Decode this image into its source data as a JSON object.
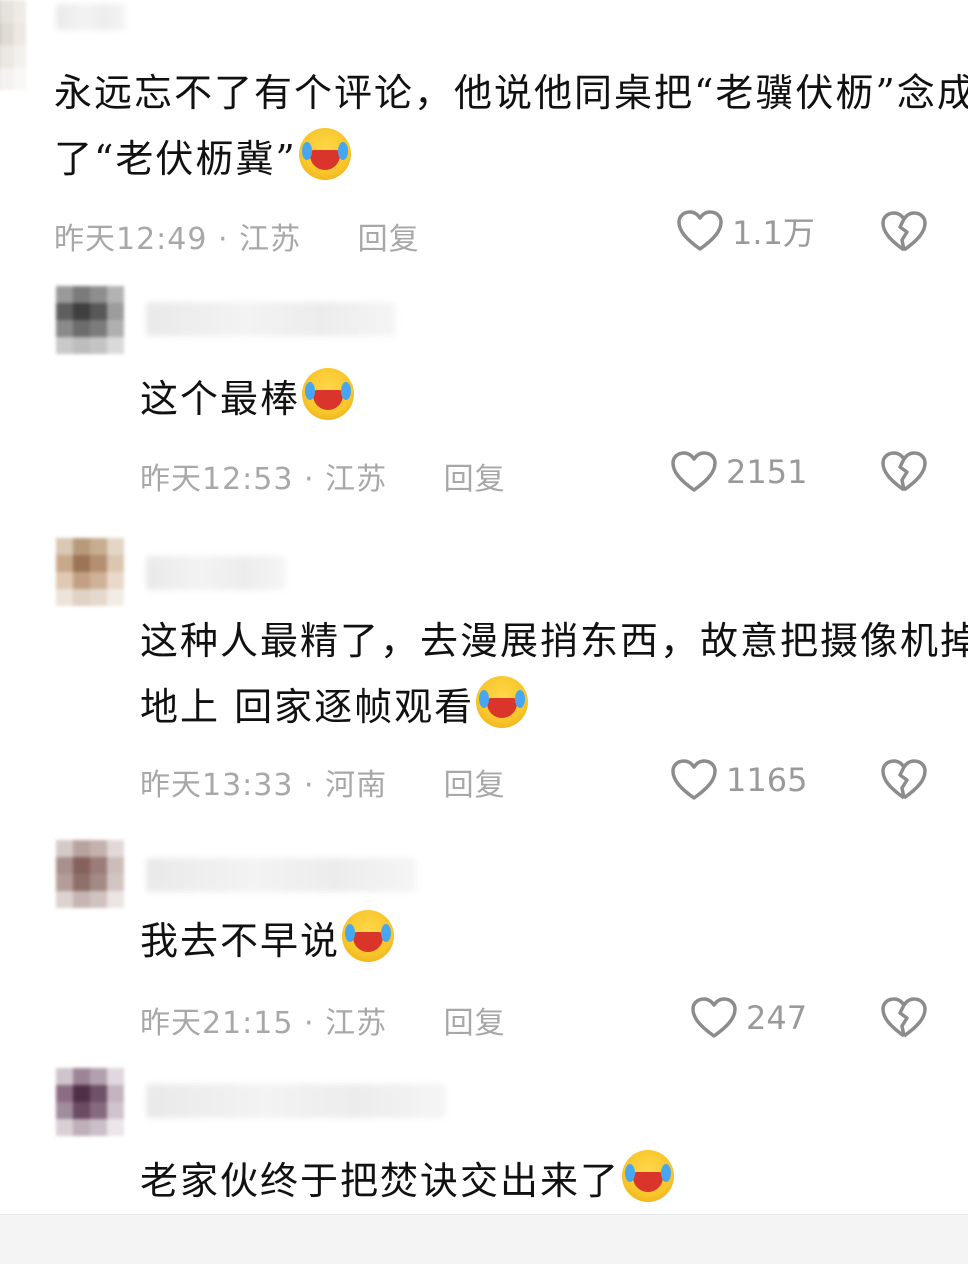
{
  "comments": [
    {
      "text_line1": "永远忘不了有个评论，他说他同桌把“老骥伏枥”念成",
      "text_line2": "了“老伏枥冀”",
      "time": "昨天12:49",
      "separator": "·",
      "location": "江苏",
      "reply": "回复",
      "likes": "1.1万"
    },
    {
      "text_line1": "这个最棒",
      "time": "昨天12:53",
      "separator": "·",
      "location": "江苏",
      "reply": "回复",
      "likes": "2151"
    },
    {
      "text_line1": "这种人最精了，去漫展捎东西，故意把摄像机掉",
      "text_line2": "地上 回家逐帧观看",
      "time": "昨天13:33",
      "separator": "·",
      "location": "河南",
      "reply": "回复",
      "likes": "1165"
    },
    {
      "text_line1": "我去不早说",
      "time": "昨天21:15",
      "separator": "·",
      "location": "江苏",
      "reply": "回复",
      "likes": "247"
    },
    {
      "text_line1": "老家伙终于把焚诀交出来了"
    }
  ],
  "icons": {
    "like": "heart-outline-icon",
    "dislike": "broken-heart-icon",
    "emoji": "laughing-crying-emoji"
  },
  "colors": {
    "meta_text": "#a8a8a8",
    "icon_stroke": "#8c8c8c",
    "emoji_yellow": "#f8c52a"
  }
}
